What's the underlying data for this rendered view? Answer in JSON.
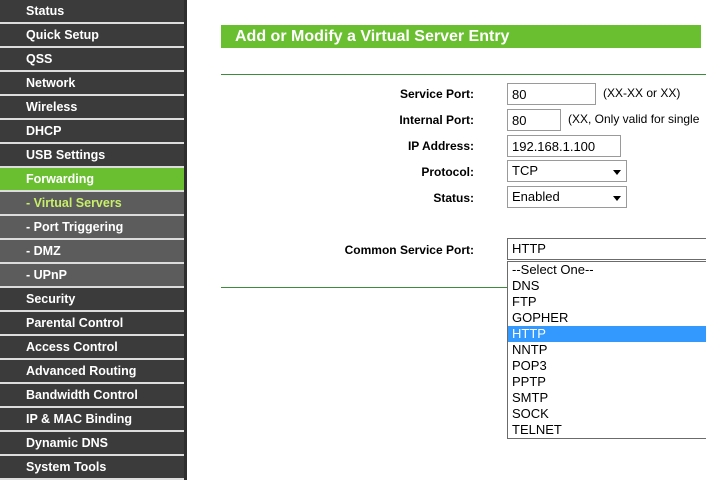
{
  "sidebar": {
    "items": [
      {
        "label": "Status"
      },
      {
        "label": "Quick Setup"
      },
      {
        "label": "QSS"
      },
      {
        "label": "Network"
      },
      {
        "label": "Wireless"
      },
      {
        "label": "DHCP"
      },
      {
        "label": "USB Settings"
      },
      {
        "label": "Forwarding"
      },
      {
        "label": "- Virtual Servers"
      },
      {
        "label": "- Port Triggering"
      },
      {
        "label": "- DMZ"
      },
      {
        "label": "- UPnP"
      },
      {
        "label": "Security"
      },
      {
        "label": "Parental Control"
      },
      {
        "label": "Access Control"
      },
      {
        "label": "Advanced Routing"
      },
      {
        "label": "Bandwidth Control"
      },
      {
        "label": "IP & MAC Binding"
      },
      {
        "label": "Dynamic DNS"
      },
      {
        "label": "System Tools"
      }
    ]
  },
  "main": {
    "title": "Add or Modify a Virtual Server Entry",
    "service_port": {
      "label": "Service Port:",
      "value": "80",
      "hint": "(XX-XX or XX)"
    },
    "internal_port": {
      "label": "Internal Port:",
      "value": "80",
      "hint": "(XX, Only valid for single"
    },
    "ip_address": {
      "label": "IP Address:",
      "value": "192.168.1.100"
    },
    "protocol": {
      "label": "Protocol:",
      "value": "TCP"
    },
    "status": {
      "label": "Status:",
      "value": "Enabled"
    },
    "common_service_port": {
      "label": "Common Service Port:",
      "value": "HTTP",
      "options": [
        "--Select One--",
        "DNS",
        "FTP",
        "GOPHER",
        "HTTP",
        "NNTP",
        "POP3",
        "PPTP",
        "SMTP",
        "SOCK",
        "TELNET"
      ]
    }
  },
  "colors": {
    "accent": "#6abf30",
    "sidebar_bg": "#3b3b3b",
    "submenu_bg": "#5c5c5c",
    "highlight": "#3399ff"
  }
}
